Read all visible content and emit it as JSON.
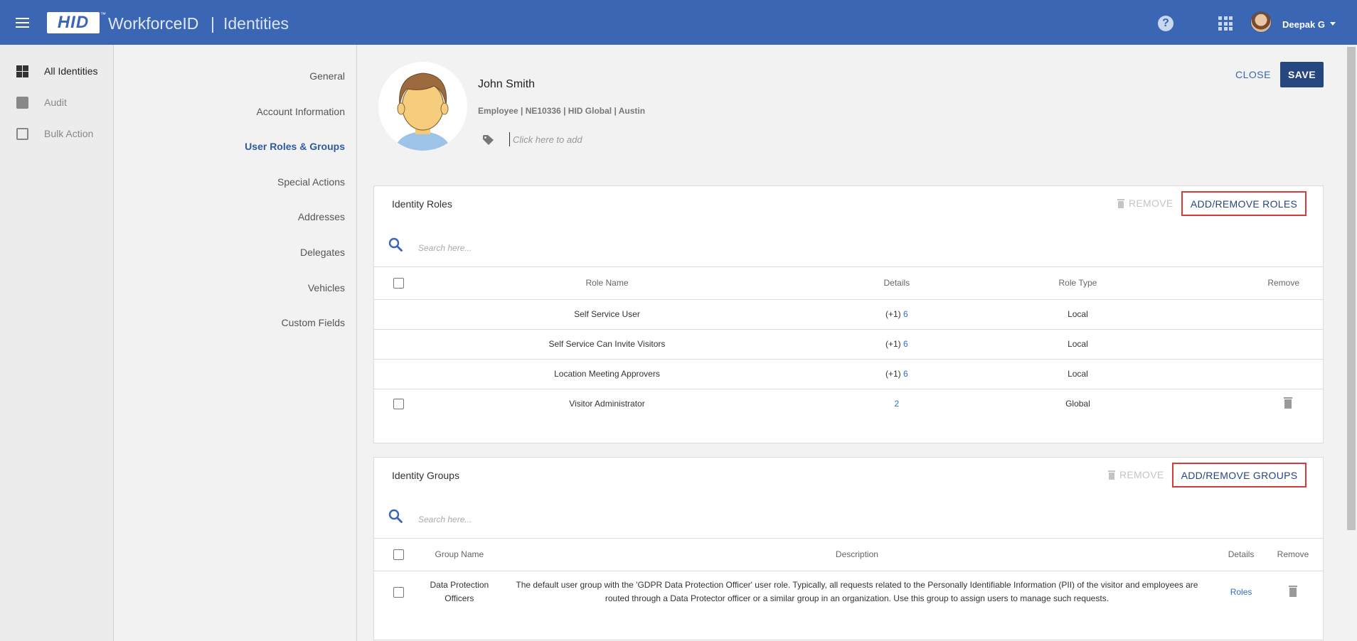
{
  "header": {
    "brand": "HID",
    "product": "WorkforceID",
    "trademark": "™",
    "separator": "|",
    "app": "Identities",
    "user": "Deepak G",
    "menu_icon": "hamburger-icon",
    "help_icon": "help-icon",
    "apps_icon": "apps-grid-icon",
    "brand_color": "#3a66b3"
  },
  "leftnav": {
    "items": [
      {
        "label": "All Identities",
        "icon": "dashboard-icon",
        "active": true
      },
      {
        "label": "Audit",
        "icon": "clipboard-check-icon",
        "active": false
      },
      {
        "label": "Bulk Action",
        "icon": "bulk-action-icon",
        "active": false
      }
    ]
  },
  "sections": {
    "items": [
      {
        "label": "General"
      },
      {
        "label": "Account Information"
      },
      {
        "label": "User Roles & Groups",
        "active": true
      },
      {
        "label": "Special Actions"
      },
      {
        "label": "Addresses"
      },
      {
        "label": "Delegates"
      },
      {
        "label": "Vehicles"
      },
      {
        "label": "Custom Fields"
      }
    ]
  },
  "profile": {
    "name": "John Smith",
    "meta": "Employee | NE10336 | HID Global | Austin",
    "tag_placeholder": "Click here to add"
  },
  "actions": {
    "close": "CLOSE",
    "save": "SAVE"
  },
  "roles": {
    "title": "Identity Roles",
    "remove": "REMOVE",
    "add_remove": "ADD/REMOVE ROLES",
    "search_placeholder": "Search here...",
    "columns": {
      "name": "Role Name",
      "details": "Details",
      "type": "Role Type",
      "remove": "Remove"
    },
    "rows": [
      {
        "name": "Self Service User",
        "details_prefix": "(+1)",
        "details_link": "6",
        "type": "Local",
        "selectable": false
      },
      {
        "name": "Self Service Can Invite Visitors",
        "details_prefix": "(+1)",
        "details_link": "6",
        "type": "Local",
        "selectable": false
      },
      {
        "name": "Location Meeting Approvers",
        "details_prefix": "(+1)",
        "details_link": "6",
        "type": "Local",
        "selectable": false
      },
      {
        "name": "Visitor Administrator",
        "details_prefix": "",
        "details_link": "2",
        "type": "Global",
        "selectable": true
      }
    ]
  },
  "groups": {
    "title": "Identity Groups",
    "remove": "REMOVE",
    "add_remove": "ADD/REMOVE GROUPS",
    "search_placeholder": "Search here...",
    "columns": {
      "name": "Group Name",
      "description": "Description",
      "details": "Details",
      "remove": "Remove"
    },
    "rows": [
      {
        "name_line1": "Data Protection",
        "name_line2": "Officers",
        "description": "The default user group with the 'GDPR Data Protection Officer' user role. Typically, all requests related to the Personally Identifiable Information (PII) of the visitor and employees are routed through a Data Protector officer or a similar group in an organization. Use this group to assign users to manage such requests.",
        "details_link": "Roles"
      }
    ]
  }
}
